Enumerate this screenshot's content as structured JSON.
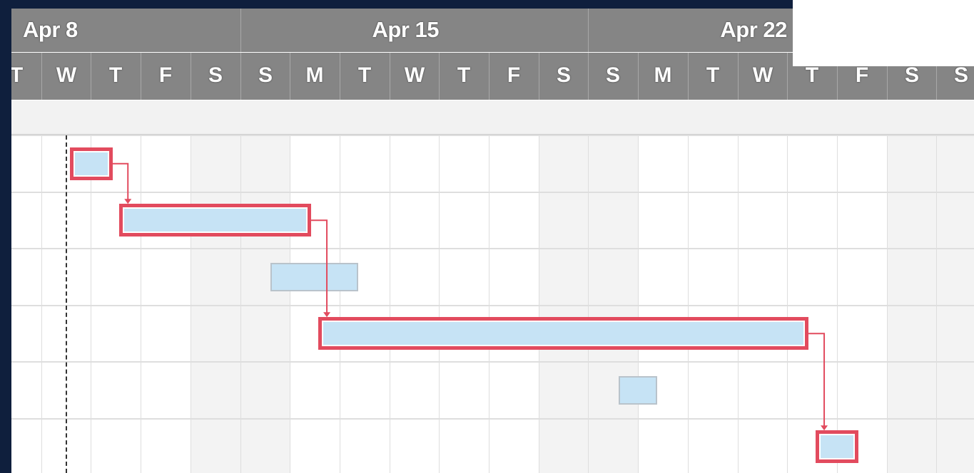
{
  "colors": {
    "header_bg": "#858585",
    "weekend_shade": "#f3f3f3",
    "bar_fill": "#c6e3f5",
    "critical_border": "#e24b5e",
    "today_line": "#333333",
    "frame_bg": "#0f1f3d"
  },
  "timeline": {
    "weeks": [
      {
        "label": "Apr 8"
      },
      {
        "label": "Apr 15"
      },
      {
        "label": "Apr 22"
      }
    ],
    "days": [
      {
        "label": "T",
        "weekend": false
      },
      {
        "label": "W",
        "weekend": false
      },
      {
        "label": "T",
        "weekend": false
      },
      {
        "label": "F",
        "weekend": false
      },
      {
        "label": "S",
        "weekend": true
      },
      {
        "label": "S",
        "weekend": true
      },
      {
        "label": "M",
        "weekend": false
      },
      {
        "label": "T",
        "weekend": false
      },
      {
        "label": "W",
        "weekend": false
      },
      {
        "label": "T",
        "weekend": false
      },
      {
        "label": "F",
        "weekend": false
      },
      {
        "label": "S",
        "weekend": true
      },
      {
        "label": "S",
        "weekend": true
      },
      {
        "label": "M",
        "weekend": false
      },
      {
        "label": "T",
        "weekend": false
      },
      {
        "label": "W",
        "weekend": false
      },
      {
        "label": "T",
        "weekend": false
      },
      {
        "label": "F",
        "weekend": false
      },
      {
        "label": "S",
        "weekend": true
      },
      {
        "label": "S",
        "weekend": true
      }
    ]
  },
  "today_marker": {
    "day_index": 1.5
  },
  "tasks": [
    {
      "start_day": 1.5,
      "duration_days": 1,
      "critical": true
    },
    {
      "start_day": 2.5,
      "duration_days": 4,
      "critical": true
    },
    {
      "start_day": 5.5,
      "duration_days": 2,
      "critical": false
    },
    {
      "start_day": 6.5,
      "duration_days": 10,
      "critical": true
    },
    {
      "start_day": 12.5,
      "duration_days": 1,
      "critical": false
    },
    {
      "start_day": 16.5,
      "duration_days": 1,
      "critical": true
    }
  ],
  "dependencies": [
    {
      "from": 0,
      "to": 1
    },
    {
      "from": 1,
      "to": 3
    },
    {
      "from": 3,
      "to": 5
    }
  ]
}
